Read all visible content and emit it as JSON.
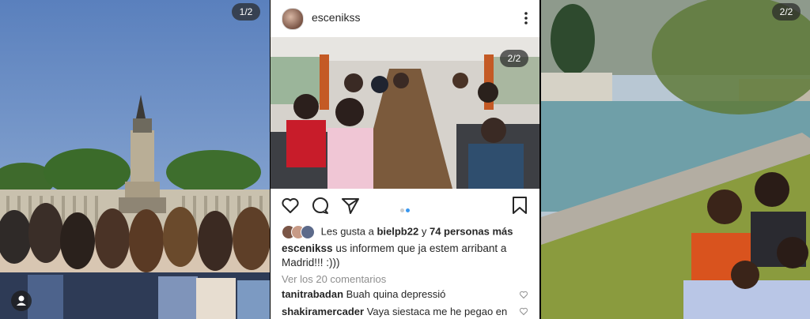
{
  "panel_left": {
    "counter": "1/2"
  },
  "post": {
    "username": "escenikss",
    "photo_counter": "2/2",
    "likes": {
      "prefix": "Les gusta a",
      "user": "bielpb22",
      "connector": "y",
      "others": "74 personas más"
    },
    "caption": {
      "user": "escenikss",
      "text": "us informem que ja estem arribant a Madrid!!! :)))"
    },
    "view_comments": "Ver los 20 comentarios",
    "comments": [
      {
        "user": "tanitrabadan",
        "text": "Buah quina depressió"
      },
      {
        "user": "shakiramercader",
        "text": "Vaya siestaca me he pegao en"
      }
    ]
  },
  "panel_right": {
    "counter": "2/2"
  }
}
